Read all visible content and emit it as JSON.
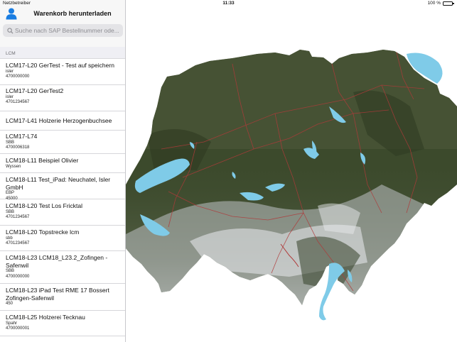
{
  "status": {
    "carrier": "Netzbetreiber",
    "time": "11:33",
    "battery": "100 %"
  },
  "sidebar": {
    "title": "Warenkorb herunterladen",
    "search": {
      "placeholder": "Suche nach SAP Bestellnummer ode..."
    },
    "section": "LCM",
    "items": [
      {
        "title": "LCM17-L20 GerTest - Test auf speichern",
        "lines": [
          "isler",
          "4700000000"
        ]
      },
      {
        "title": "LCM17-L20 GerTest2",
        "lines": [
          "isler",
          "4701234567"
        ]
      },
      {
        "title": "LCM17-L41 Holzerie Herzogenbuchsee",
        "lines": []
      },
      {
        "title": "LCM17-L74",
        "lines": [
          "SBB",
          "4700006318"
        ]
      },
      {
        "title": "LCM18-L11 Beispiel Olivier",
        "lines": [
          "Wyssen"
        ]
      },
      {
        "title": "LCM18-L11 Test_iPad: Neuchatel, Isler GmbH",
        "lines": [
          "EBP",
          "45000"
        ]
      },
      {
        "title": "LCM18-L20 Test Los Fricktal",
        "lines": [
          "SBB",
          "4701234567"
        ]
      },
      {
        "title": "LCM18-L20 Topstrecke lcm",
        "lines": [
          "sbb",
          "4701234567"
        ]
      },
      {
        "title": "LCM18-L23 LCM18_L23.2_Zofingen - Safenwil",
        "lines": [
          "SBB",
          "4700000000"
        ]
      },
      {
        "title": "LCM18-L23 iPad Test RME 17 Bossert Zofingen-Safenwil",
        "lines": [
          "450"
        ]
      },
      {
        "title": "LCM18-L25 Holzerei Tecknau",
        "lines": [
          "Spahr",
          "4700000001"
        ]
      }
    ]
  },
  "map": {
    "content": "relief map of Switzerland with lakes and red route network",
    "colors": {
      "forest": "#3c4a2c",
      "alps": "#cfd3d6",
      "lake": "#7fcbe8",
      "route": "#b03a3a"
    }
  },
  "icons": {
    "user": "user-icon",
    "search": "search-icon",
    "battery": "battery-icon"
  }
}
